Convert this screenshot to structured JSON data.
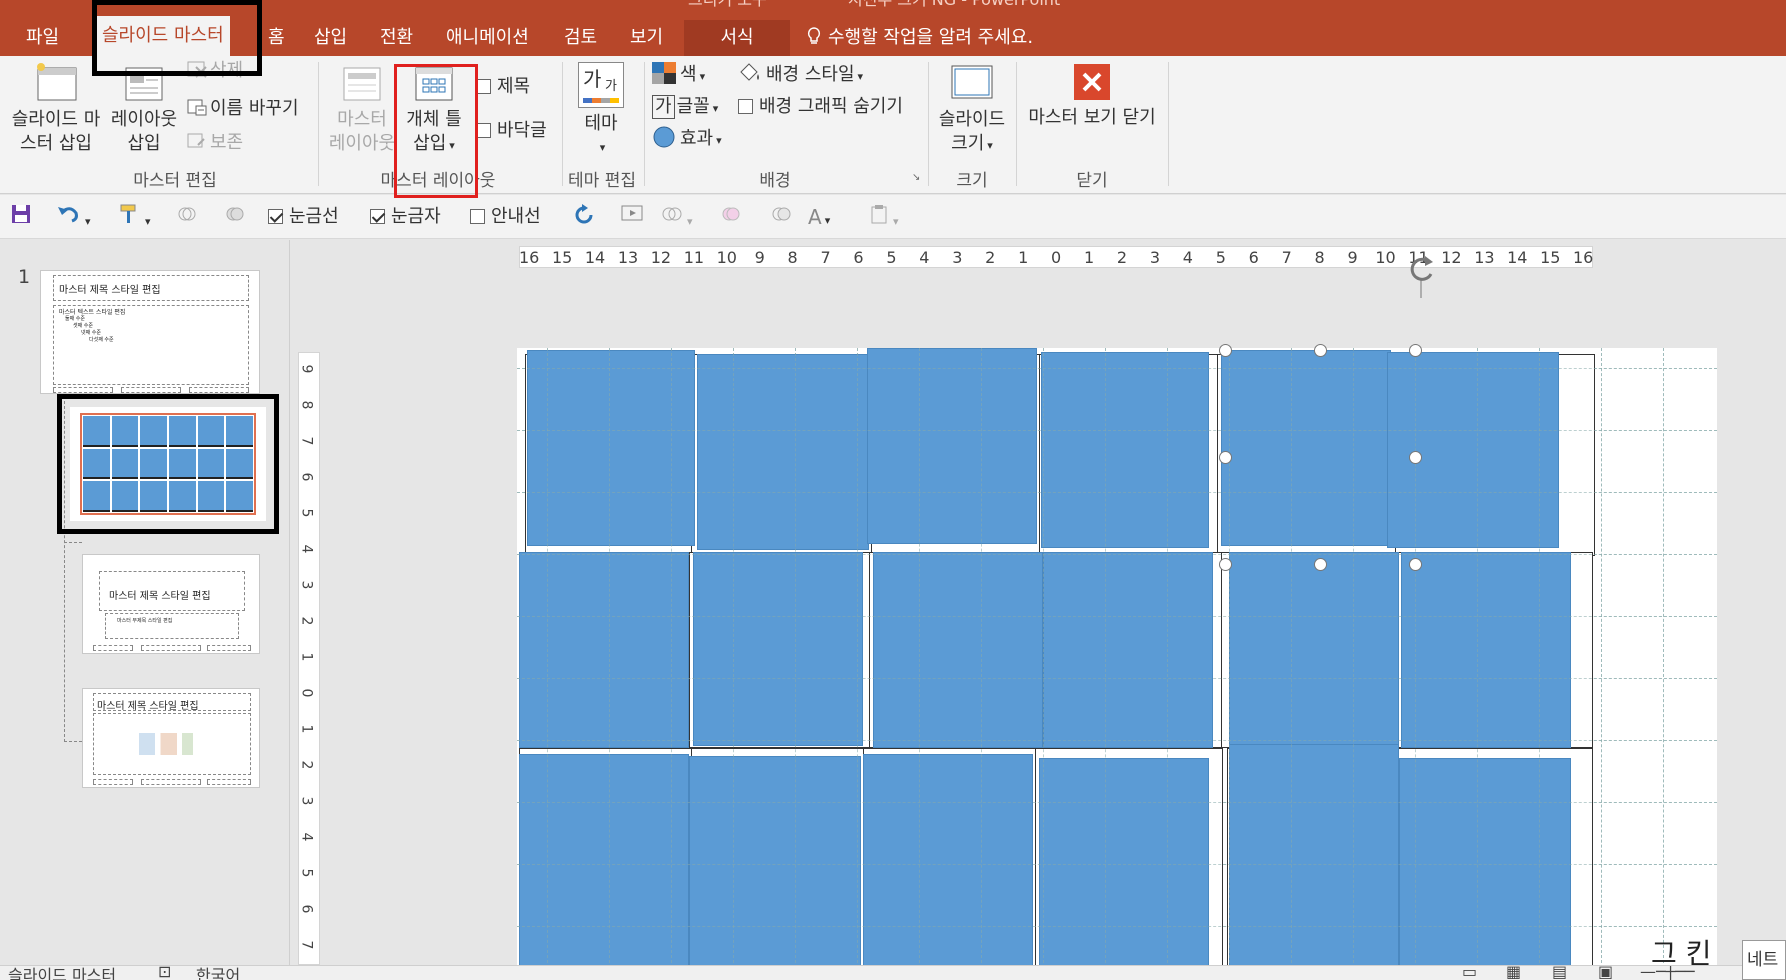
{
  "title_fragments": [
    "그리기 도구",
    "시진무 크기 NG - PowerPoint"
  ],
  "tabs": [
    {
      "label": "파일"
    },
    {
      "label": "슬라이드 마스터"
    },
    {
      "label": "홈"
    },
    {
      "label": "삽입"
    },
    {
      "label": "전환"
    },
    {
      "label": "애니메이션"
    },
    {
      "label": "검토"
    },
    {
      "label": "보기"
    },
    {
      "label": "서식"
    }
  ],
  "tell_me": "수행할 작업을 알려 주세요.",
  "ribbon": {
    "master_edit": {
      "insert_slide_master_l1": "슬라이드 마",
      "insert_slide_master_l2": "스터 삽입",
      "insert_layout_l1": "레이아웃",
      "insert_layout_l2": "삽입",
      "delete": "삭제",
      "rename": "이름 바꾸기",
      "preserve": "보존",
      "group_label": "마스터 편집"
    },
    "master_layout": {
      "master_layout_l1": "마스터",
      "master_layout_l2": "레이아웃",
      "insert_placeholder_l1": "개체 틀",
      "insert_placeholder_l2": "삽입",
      "title": "제목",
      "footer": "바닥글",
      "group_label": "마스터 레이아웃"
    },
    "theme_edit": {
      "theme": "테마",
      "theme_glyph_big": "가",
      "theme_glyph_small": "가",
      "group_label": "테마 편집"
    },
    "background": {
      "colors": "색",
      "fonts": "글꼴",
      "fonts_glyph": "가",
      "effects": "효과",
      "bg_styles": "배경 스타일",
      "hide_bg_graphics": "배경 그래픽 숨기기",
      "group_label": "배경"
    },
    "size": {
      "slide_size_l1": "슬라이드",
      "slide_size_l2": "크기",
      "group_label": "크기"
    },
    "close": {
      "close_master_view": "마스터 보기 닫기",
      "group_label": "닫기"
    }
  },
  "qat": {
    "gridlines": "눈금선",
    "ruler": "눈금자",
    "guides": "안내선",
    "gridlines_checked": true,
    "ruler_checked": true,
    "guides_checked": false
  },
  "thumbnails": {
    "slide_number": "1",
    "master_title": "마스터 제목 스타일 편집",
    "master_text": "마스터 텍스트 스타일 편집",
    "level2": "둘째 수준",
    "level3": "셋째 수준",
    "level4": "넷째 수준",
    "level5": "다섯째 수준",
    "layout3_title": "마스터 제목 스타일 편집",
    "layout3_sub": "마스터 부제목 스타일 편집",
    "layout4_title": "마스터 제목 스타일 편집"
  },
  "ruler": {
    "horizontal": [
      "16",
      "15",
      "14",
      "13",
      "12",
      "11",
      "10",
      "9",
      "8",
      "7",
      "6",
      "5",
      "4",
      "3",
      "2",
      "1",
      "0",
      "1",
      "2",
      "3",
      "4",
      "5",
      "6",
      "7",
      "8",
      "9",
      "10",
      "11",
      "12",
      "13",
      "14",
      "15",
      "16"
    ],
    "vertical": [
      "9",
      "8",
      "7",
      "6",
      "5",
      "4",
      "3",
      "2",
      "1",
      "0",
      "1",
      "2",
      "3",
      "4",
      "5",
      "6",
      "7"
    ]
  },
  "slide": {
    "partial_text": "그 킨"
  },
  "statusbar": {
    "view": "슬라이드 마스터",
    "language": "한국어"
  },
  "tooltip": "네트",
  "colors": {
    "ribbon_accent": "#b7472a",
    "tile_blue": "#5b9bd5",
    "annotation_red": "#e0201e",
    "annotation_black": "#000000"
  }
}
